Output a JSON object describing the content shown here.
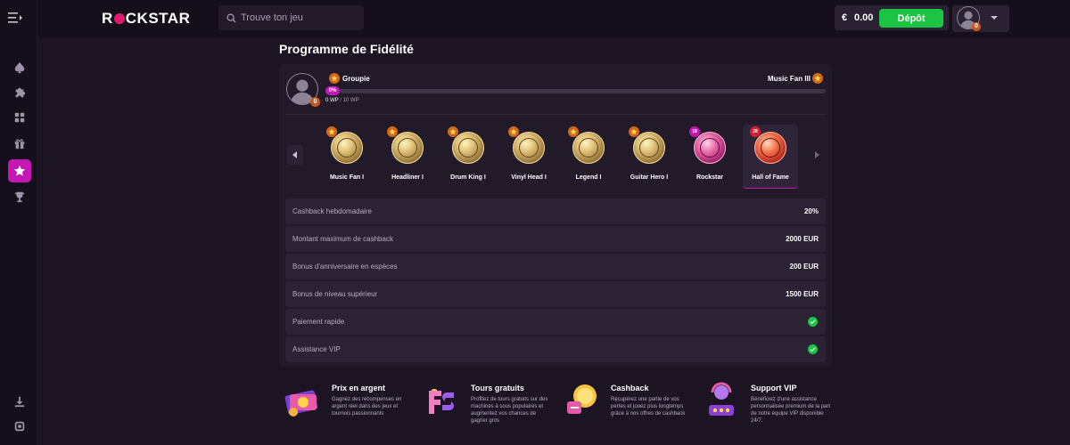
{
  "header": {
    "logo": "ROCKSTAR",
    "logo_left": "R",
    "logo_right": "CKSTAR",
    "search_placeholder": "Trouve ton jeu",
    "currency": "€",
    "balance": "0.00",
    "deposit_label": "Dépôt",
    "user_level_badge": "0"
  },
  "sidebar": {
    "items": [
      {
        "icon": "spade-icon"
      },
      {
        "icon": "puzzle-icon"
      },
      {
        "icon": "grid-icon"
      },
      {
        "icon": "gift-icon"
      },
      {
        "icon": "star-icon",
        "active": true
      },
      {
        "icon": "trophy-icon"
      }
    ],
    "bottom": [
      {
        "icon": "download-icon"
      },
      {
        "icon": "settings-icon"
      }
    ]
  },
  "page": {
    "title": "Programme de Fidélité"
  },
  "progress": {
    "current_level": "Groupie",
    "next_level": "Music Fan III",
    "percent_label": "0%",
    "percent": 0,
    "wp_current": "0 WP",
    "wp_separator": " / ",
    "wp_target": "10 WP",
    "avatar_badge": "0"
  },
  "tiers": [
    {
      "name": "Music Fan I",
      "style": "gold"
    },
    {
      "name": "Headliner I",
      "style": "gold"
    },
    {
      "name": "Drum King I",
      "style": "gold"
    },
    {
      "name": "Vinyl Head I",
      "style": "gold"
    },
    {
      "name": "Legend I",
      "style": "gold"
    },
    {
      "name": "Guitar Hero I",
      "style": "gold"
    },
    {
      "name": "Rockstar",
      "style": "pink",
      "badge": "18"
    },
    {
      "name": "Hall of Fame",
      "style": "red",
      "badge": "28",
      "selected": true
    }
  ],
  "benefits": [
    {
      "label": "Cashback hebdomadaire",
      "value": "20%"
    },
    {
      "label": "Montant maximum de cashback",
      "value": "2000 EUR"
    },
    {
      "label": "Bonus d'anniversaire en espèces",
      "value": "200 EUR"
    },
    {
      "label": "Bonus de niveau supérieur",
      "value": "1500 EUR"
    },
    {
      "label": "Paiement rapide",
      "value": "check"
    },
    {
      "label": "Assistance VIP",
      "value": "check"
    }
  ],
  "features": [
    {
      "title": "Prix en argent",
      "desc": "Gagnez des récompenses en argent réel dans des jeux et tournois passionnants"
    },
    {
      "title": "Tours gratuits",
      "desc": "Profitez de tours gratuits sur des machines à sous populaires et augmentez vos chances de gagner gros"
    },
    {
      "title": "Cashback",
      "desc": "Récupérez une partie de vos pertes et jouez plus longtemps grâce à nos offres de cashback"
    },
    {
      "title": "Support VIP",
      "desc": "Bénéficiez d'une assistance personnalisée premium de la part de notre équipe VIP disponible 24/7."
    }
  ],
  "colors": {
    "accent": "#c417b4",
    "deposit": "#1cc443",
    "background": "#1c1423",
    "panel": "#221a29"
  }
}
